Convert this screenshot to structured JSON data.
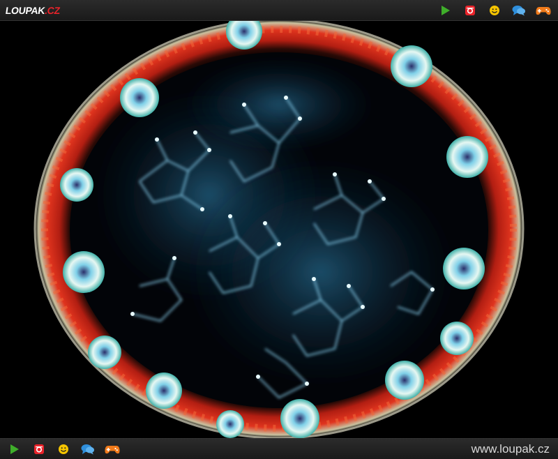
{
  "header": {
    "logo_main": "LOUPAK",
    "logo_tld": ".CZ",
    "icons": [
      "play-icon",
      "instagram-icon",
      "smiley-icon",
      "chat-icon",
      "gamepad-icon"
    ]
  },
  "footer": {
    "icons": [
      "play-icon",
      "instagram-icon",
      "smiley-icon",
      "chat-icon",
      "gamepad-icon"
    ],
    "site_url": "www.loupak.cz"
  },
  "colors": {
    "play": "#3fae2a",
    "instagram": "#e8232a",
    "smiley": "#f5c400",
    "chat": "#2f8fdc",
    "gamepad": "#f07a1a",
    "ring_red": "#d42a1a",
    "cell_blue": "#56c8f0"
  }
}
